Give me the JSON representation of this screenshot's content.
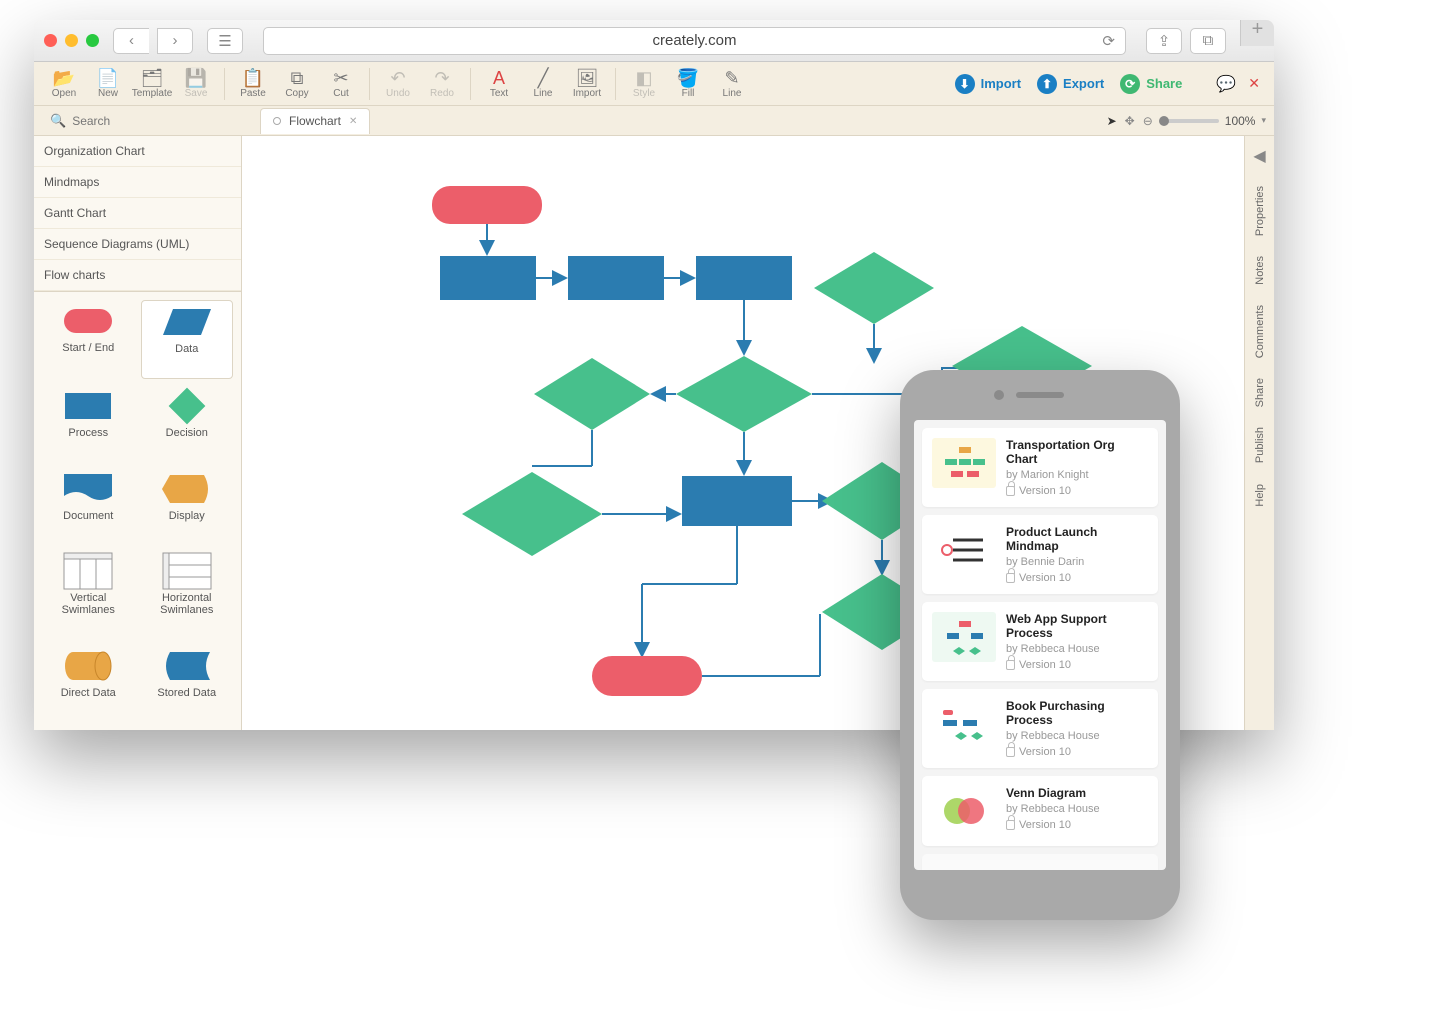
{
  "browser": {
    "url": "creately.com"
  },
  "toolbar": {
    "open": "Open",
    "new": "New",
    "template": "Template",
    "save": "Save",
    "paste": "Paste",
    "copy": "Copy",
    "cut": "Cut",
    "undo": "Undo",
    "redo": "Redo",
    "text": "Text",
    "line": "Line",
    "import": "Import",
    "style": "Style",
    "fill": "Fill",
    "line2": "Line",
    "import_btn": "Import",
    "export_btn": "Export",
    "share_btn": "Share"
  },
  "tab": {
    "name": "Flowchart"
  },
  "zoom": {
    "value": "100%"
  },
  "search": {
    "placeholder": "Search"
  },
  "categories": [
    "Organization Chart",
    "Mindmaps",
    "Gantt Chart",
    "Sequence Diagrams (UML)",
    "Flow charts"
  ],
  "shapes": [
    {
      "label": "Start / End"
    },
    {
      "label": "Data"
    },
    {
      "label": "Process"
    },
    {
      "label": "Decision"
    },
    {
      "label": "Document"
    },
    {
      "label": "Display"
    },
    {
      "label": "Vertical Swimlanes"
    },
    {
      "label": "Horizontal Swimlanes"
    },
    {
      "label": "Direct Data"
    },
    {
      "label": "Stored Data"
    }
  ],
  "rail": [
    "Properties",
    "Notes",
    "Comments",
    "Share",
    "Publish",
    "Help"
  ],
  "mobile": {
    "items": [
      {
        "title": "Transportation Org Chart",
        "author": "by Marion Knight",
        "version": "Version 10",
        "thumb": "org"
      },
      {
        "title": "Product Launch Mindmap",
        "author": "by Bennie Darin",
        "version": "Version 10",
        "thumb": "mind"
      },
      {
        "title": "Web App Support Process",
        "author": "by Rebbeca House",
        "version": "Version 10",
        "thumb": "flow"
      },
      {
        "title": "Book Purchasing Process",
        "author": "by Rebbeca House",
        "version": "Version 10",
        "thumb": "flow2"
      },
      {
        "title": "Venn Diagram",
        "author": "by Rebbeca House",
        "version": "Version 10",
        "thumb": "venn"
      }
    ]
  }
}
